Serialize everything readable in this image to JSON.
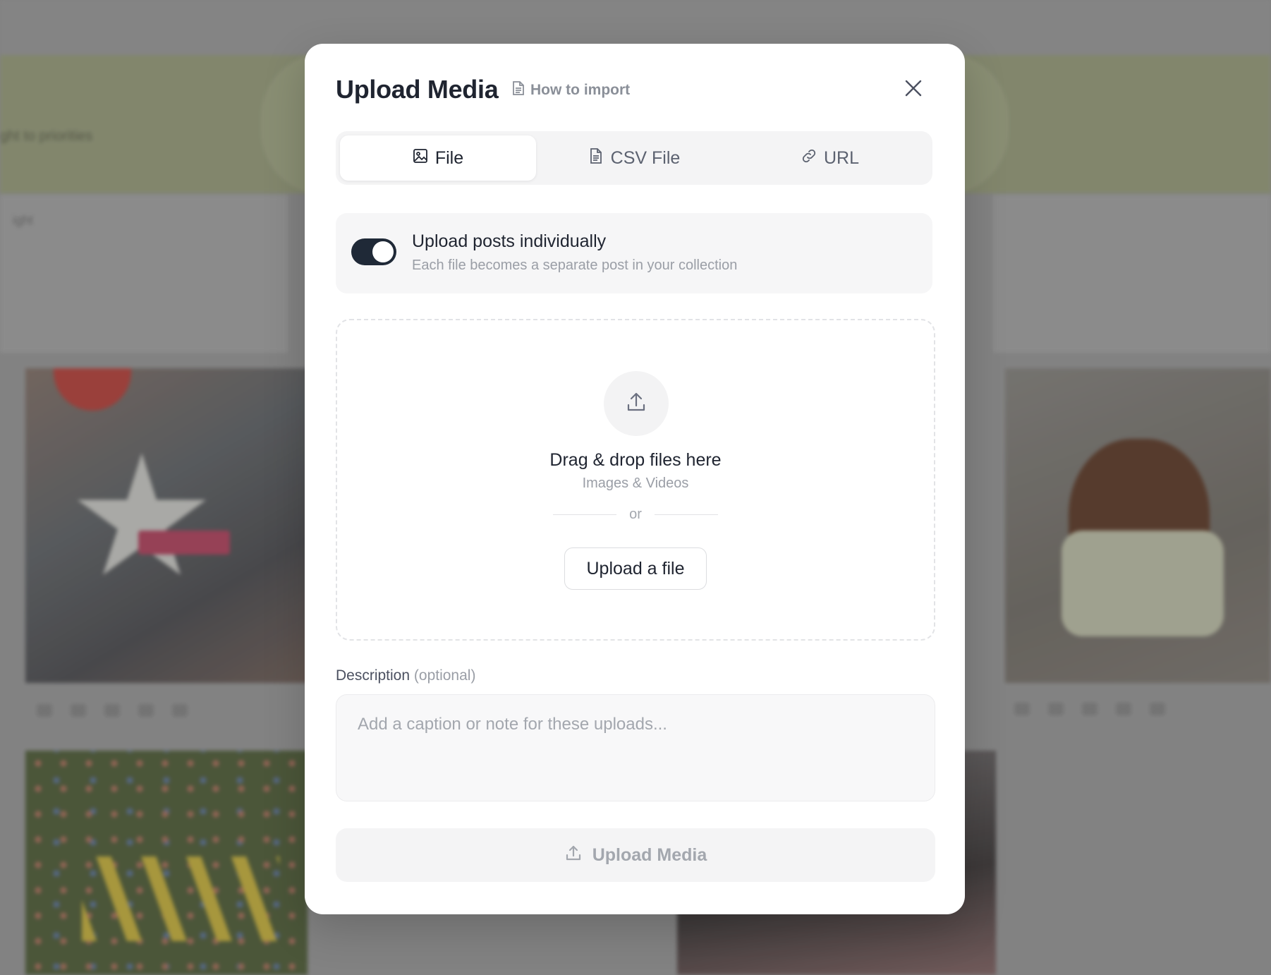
{
  "background": {
    "banner_text": "ght to priorities",
    "panel_text": "ight"
  },
  "modal": {
    "title": "Upload Media",
    "how_to_link": "How to import",
    "tabs": [
      {
        "label": "File",
        "icon": "image-icon",
        "active": true
      },
      {
        "label": "CSV File",
        "icon": "document-icon",
        "active": false
      },
      {
        "label": "URL",
        "icon": "link-icon",
        "active": false
      }
    ],
    "toggle": {
      "title": "Upload posts individually",
      "description": "Each file becomes a separate post in your collection",
      "on": true
    },
    "dropzone": {
      "title": "Drag & drop files here",
      "subtitle": "Images & Videos",
      "or_text": "or",
      "button_label": "Upload a file"
    },
    "description": {
      "label": "Description",
      "optional_text": "(optional)",
      "placeholder": "Add a caption or note for these uploads...",
      "value": ""
    },
    "submit_label": "Upload Media"
  },
  "colors": {
    "toggle_on": "#1f2937",
    "title_text": "#1f2430",
    "muted_text": "#9a9ea6"
  }
}
